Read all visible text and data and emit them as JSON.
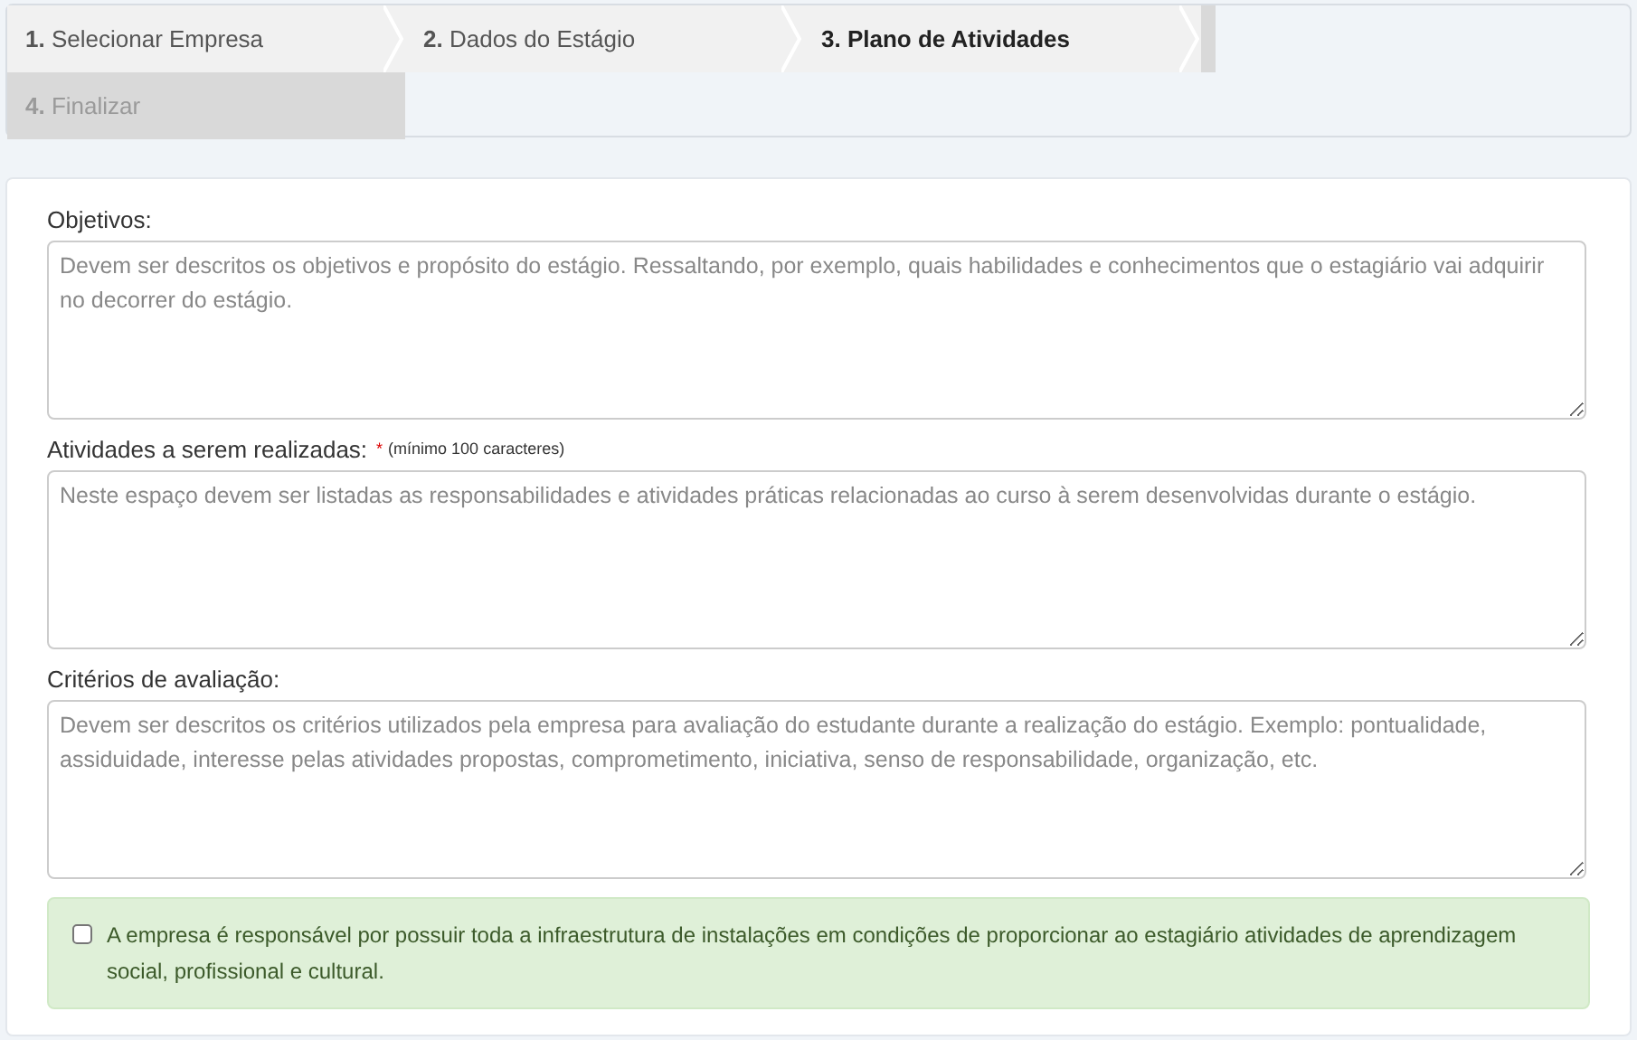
{
  "steps": [
    {
      "number": "1.",
      "label": "Selecionar Empresa",
      "selected": false,
      "disabled": false
    },
    {
      "number": "2.",
      "label": "Dados do Estágio",
      "selected": false,
      "disabled": false
    },
    {
      "number": "3.",
      "label": "Plano de Atividades",
      "selected": true,
      "disabled": false
    },
    {
      "number": "4.",
      "label": "Finalizar",
      "selected": false,
      "disabled": true
    }
  ],
  "fields": [
    {
      "label": "Objetivos:",
      "placeholder": "Devem ser descritos os objetivos e propósito do estágio. Ressaltando, por exemplo, quais habilidades e conhecimentos que o estagiário vai adquirir no decorrer do estágio."
    },
    {
      "label": "Atividades a serem realizadas:",
      "required_mark": "*",
      "note": "(mínimo 100 caracteres)",
      "placeholder": "Neste espaço devem ser listadas as responsabilidades e atividades práticas relacionadas ao curso à serem desenvolvidas durante o estágio."
    },
    {
      "label": "Critérios de avaliação:",
      "placeholder": "Devem ser descritos os critérios utilizados pela empresa para avaliação do estudante durante a realização do estágio. Exemplo: pontualidade, assiduidade, interesse pelas atividades propostas, comprometimento, iniciativa, senso de responsabilidade, organização, etc."
    }
  ],
  "agreement": {
    "checked": false,
    "text": "A empresa é responsável por possuir toda a infraestrutura de instalações em condições de proporcionar ao estagiário atividades de aprendizagem social, profissional e cultural."
  }
}
